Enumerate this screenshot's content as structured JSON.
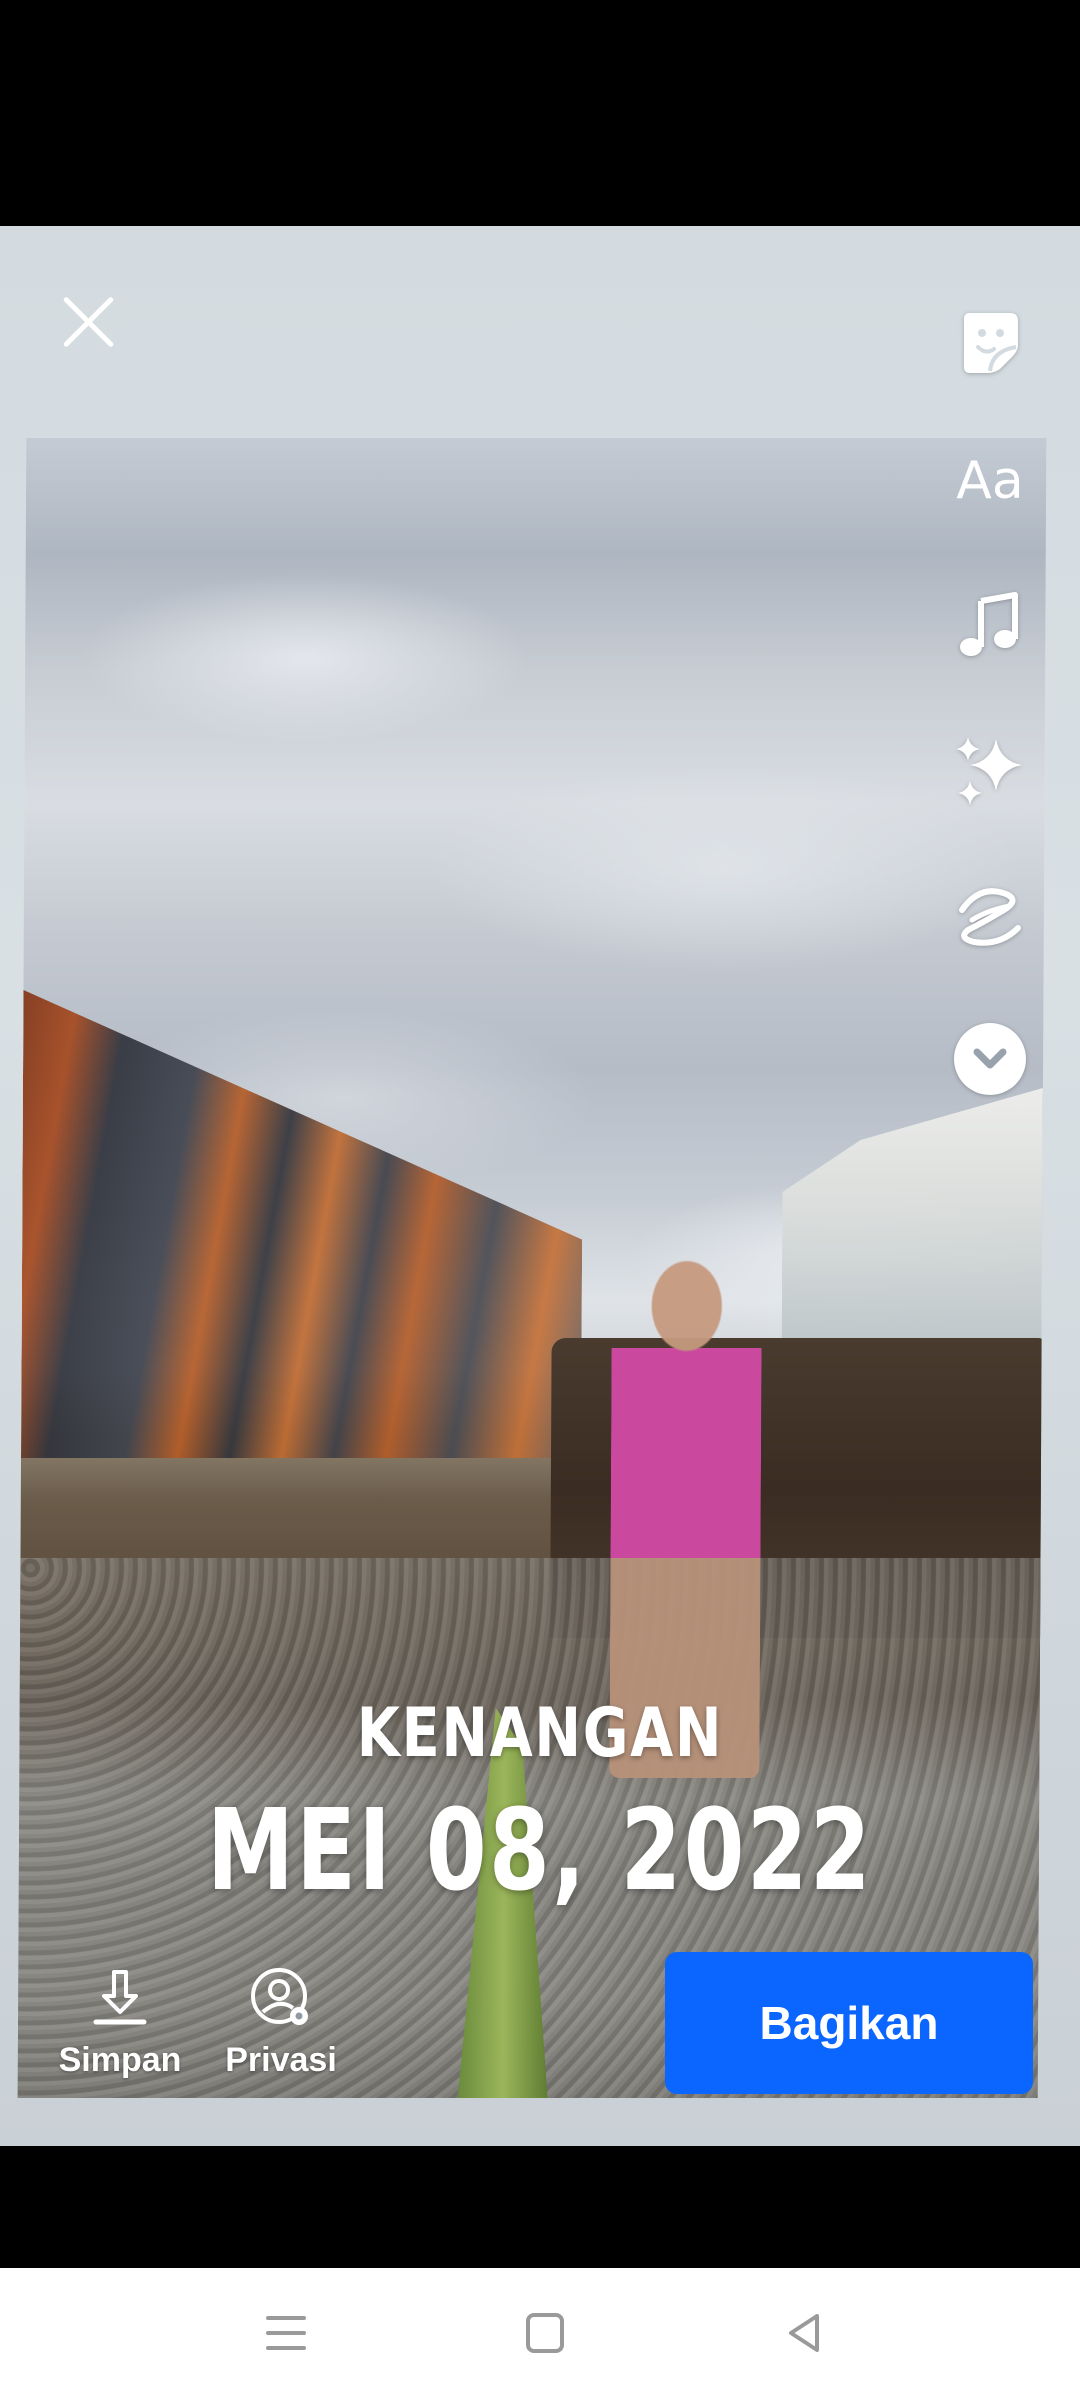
{
  "memory": {
    "label": "KENANGAN",
    "date": "MEI 08, 2022"
  },
  "tools": {
    "text_label": "Aa"
  },
  "bottom": {
    "save_label": "Simpan",
    "privacy_label": "Privasi",
    "share_label": "Bagikan"
  },
  "colors": {
    "share_button": "#0a66ff",
    "editor_background": "#d3dbe0"
  },
  "icons": [
    "close-icon",
    "sticker-icon",
    "text-icon",
    "music-icon",
    "effects-icon",
    "squiggle-icon",
    "chevron-down-icon",
    "download-icon",
    "privacy-settings-icon",
    "menu-icon",
    "home-icon",
    "back-icon"
  ]
}
